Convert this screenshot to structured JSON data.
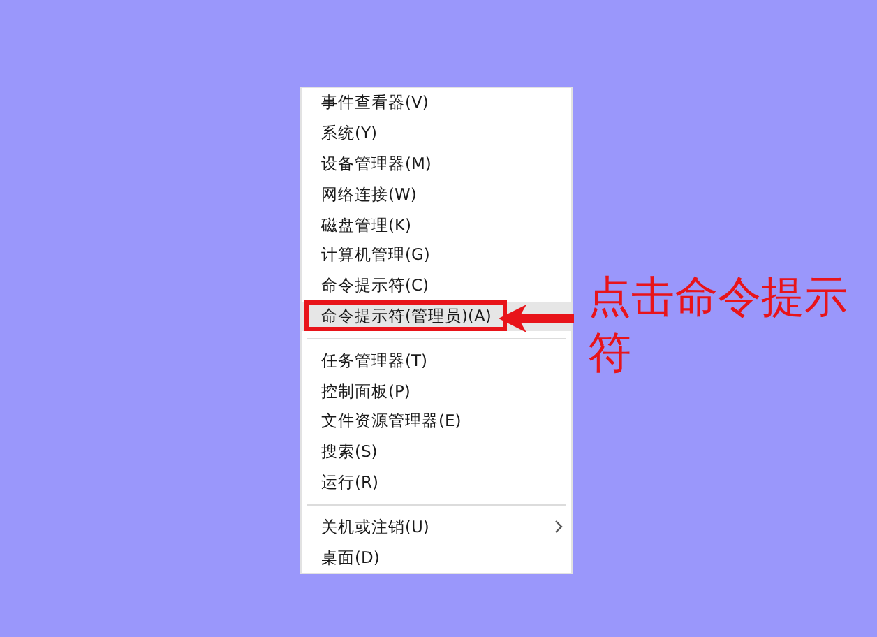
{
  "menu": {
    "sections": [
      {
        "items": [
          {
            "label": "事件查看器(V)",
            "selected": false
          },
          {
            "label": "系统(Y)",
            "selected": false
          },
          {
            "label": "设备管理器(M)",
            "selected": false
          },
          {
            "label": "网络连接(W)",
            "selected": false
          },
          {
            "label": "磁盘管理(K)",
            "selected": false
          },
          {
            "label": "计算机管理(G)",
            "selected": false
          },
          {
            "label": "命令提示符(C)",
            "selected": false
          },
          {
            "label": "命令提示符(管理员)(A)",
            "selected": true,
            "outlined": true
          }
        ]
      },
      {
        "items": [
          {
            "label": "任务管理器(T)",
            "selected": false
          },
          {
            "label": "控制面板(P)",
            "selected": false
          },
          {
            "label": "文件资源管理器(E)",
            "selected": false
          },
          {
            "label": "搜索(S)",
            "selected": false
          },
          {
            "label": "运行(R)",
            "selected": false
          }
        ]
      },
      {
        "items": [
          {
            "label": "关机或注销(U)",
            "selected": false,
            "submenu": true
          },
          {
            "label": "桌面(D)",
            "selected": false
          }
        ]
      }
    ]
  },
  "annotation": {
    "text": "点击命令提示符"
  }
}
